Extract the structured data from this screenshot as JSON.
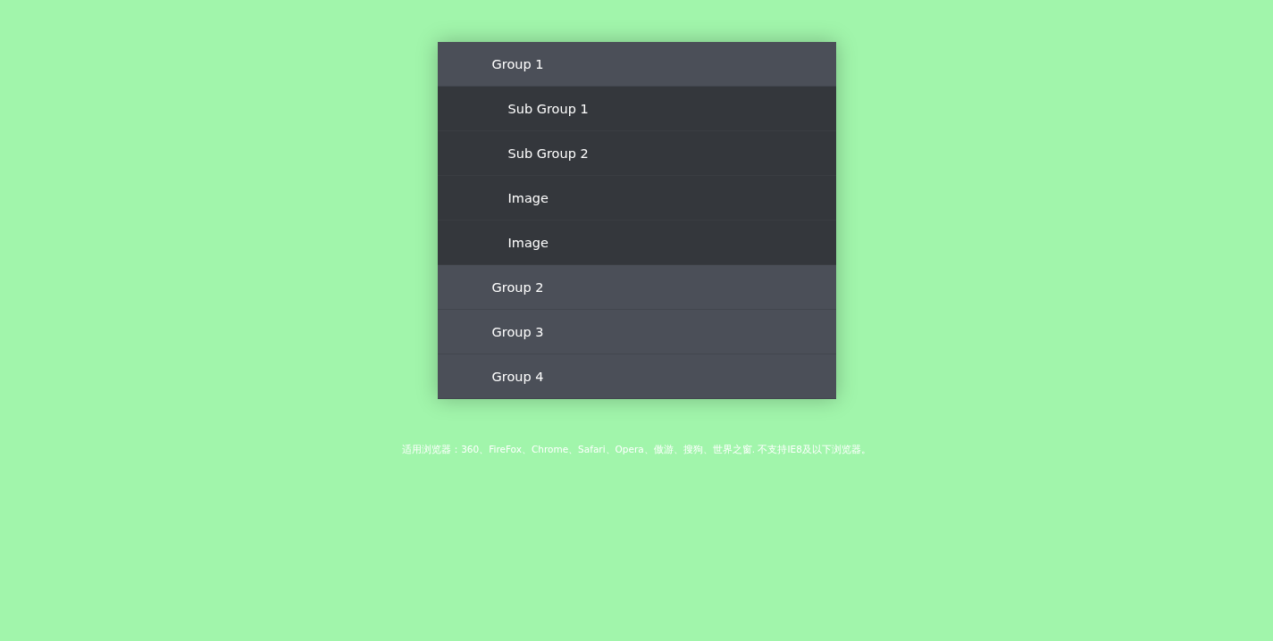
{
  "menu": [
    {
      "label": "Group 1",
      "children": [
        {
          "label": "Sub Group 1"
        },
        {
          "label": "Sub Group 2"
        },
        {
          "label": "Image"
        },
        {
          "label": "Image"
        }
      ]
    },
    {
      "label": "Group 2"
    },
    {
      "label": "Group 3"
    },
    {
      "label": "Group 4"
    }
  ],
  "footer": "适用浏览器：360、FireFox、Chrome、Safari、Opera、傲游、搜狗、世界之窗. 不支持IE8及以下浏览器。"
}
